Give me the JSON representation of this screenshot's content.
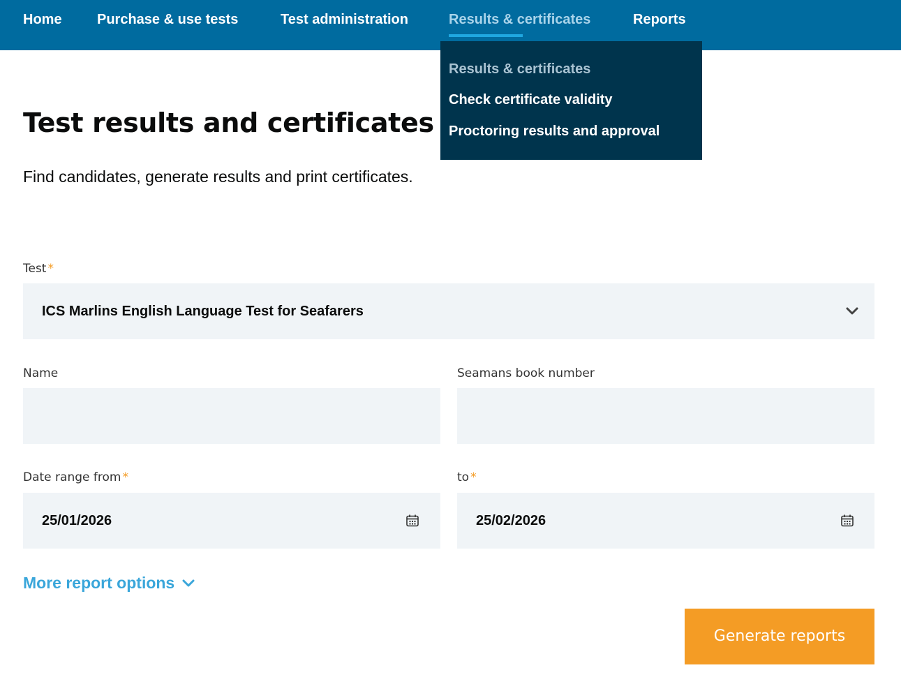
{
  "nav": {
    "items": [
      {
        "label": "Home"
      },
      {
        "label": "Purchase & use tests"
      },
      {
        "label": "Test administration"
      },
      {
        "label": "Results & certificates"
      },
      {
        "label": "Reports"
      }
    ],
    "active_index": 3,
    "dropdown": [
      {
        "label": "Results & certificates"
      },
      {
        "label": "Check certificate validity"
      },
      {
        "label": "Proctoring results and approval"
      }
    ]
  },
  "page": {
    "title": "Test results and certificates",
    "subtitle": "Find candidates, generate results and print certificates."
  },
  "form": {
    "required_mark": "*",
    "test": {
      "label": "Test",
      "value": "ICS Marlins English Language Test for Seafarers"
    },
    "name": {
      "label": "Name",
      "value": ""
    },
    "seamans_book": {
      "label": "Seamans book number",
      "value": ""
    },
    "date_from": {
      "label": "Date range from",
      "value": "25/01/2026"
    },
    "date_to": {
      "label": "to",
      "value": "25/02/2026"
    },
    "more_options": "More report options",
    "submit": "Generate reports"
  },
  "colors": {
    "nav_bg": "#006b9f",
    "dropdown_bg": "#00344d",
    "active_link": "#a9d4ea",
    "accent_link": "#3aa6da",
    "button": "#f49c25",
    "field_bg": "#f0f4f7",
    "required": "#f49c25"
  }
}
